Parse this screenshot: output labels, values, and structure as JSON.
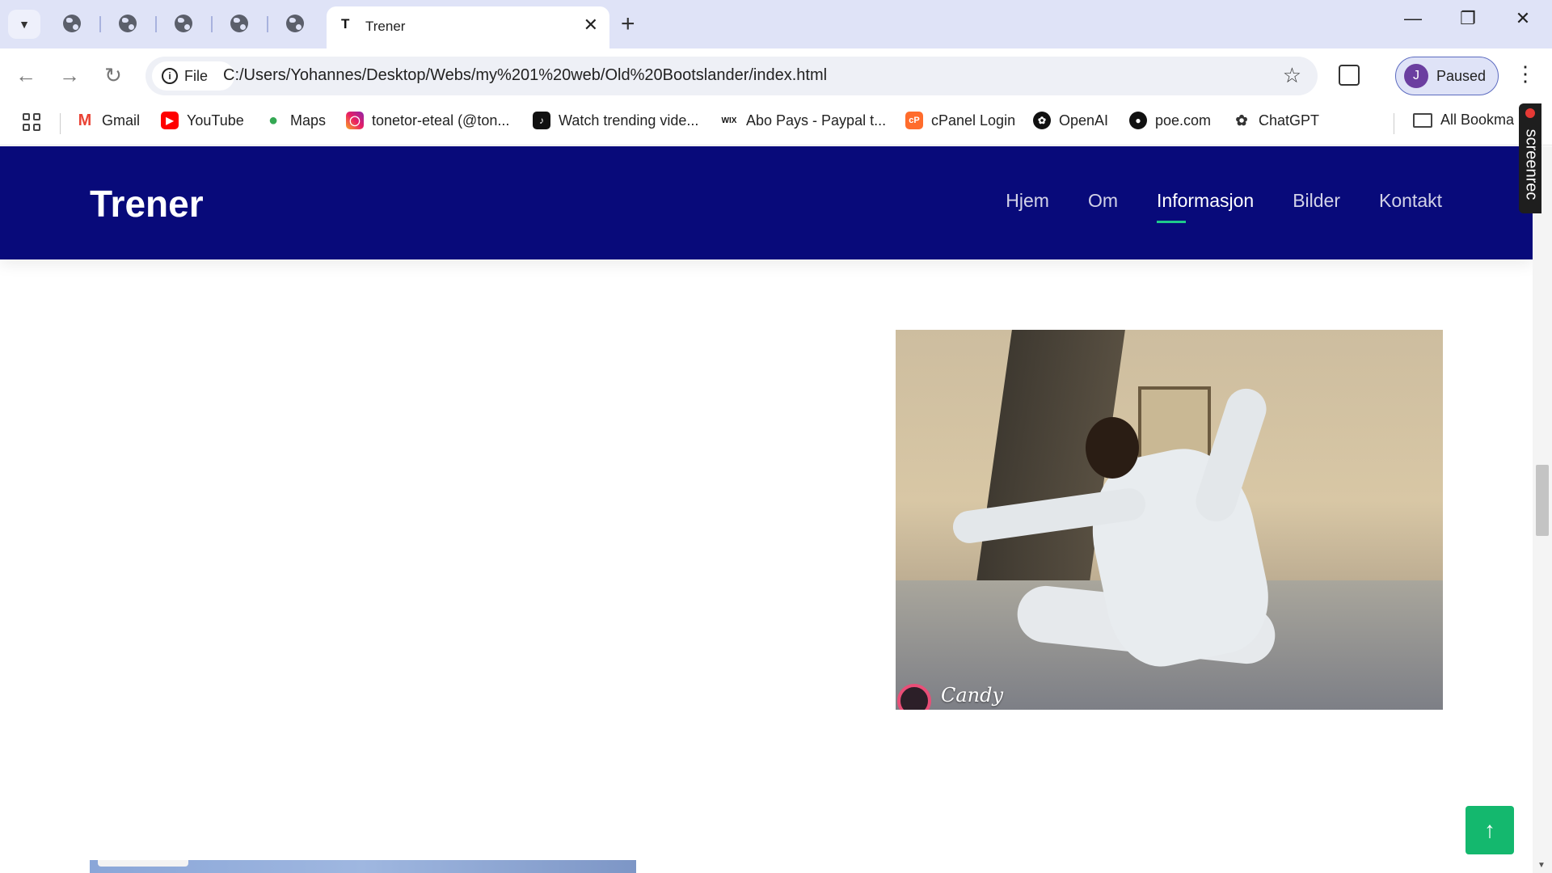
{
  "browser": {
    "active_tab": {
      "favicon": "T",
      "title": "Trener"
    },
    "omnibox": {
      "site_info_label": "File",
      "url": "C:/Users/Yohannes/Desktop/Webs/my%201%20web/Old%20Bootslander/index.html"
    },
    "profile": {
      "initial": "J",
      "status": "Paused"
    },
    "bookmarks": [
      {
        "label": "Gmail",
        "icon": "gmail-icon"
      },
      {
        "label": "YouTube",
        "icon": "youtube-icon"
      },
      {
        "label": "Maps",
        "icon": "maps-icon"
      },
      {
        "label": "tonetor-eteal (@ton...",
        "icon": "instagram-icon"
      },
      {
        "label": "Watch trending vide...",
        "icon": "tiktok-icon"
      },
      {
        "label": "Abo Pays - Paypal t...",
        "icon": "wix-icon"
      },
      {
        "label": "cPanel Login",
        "icon": "cpanel-icon"
      },
      {
        "label": "OpenAI",
        "icon": "openai-icon"
      },
      {
        "label": "poe.com",
        "icon": "poe-icon"
      },
      {
        "label": "ChatGPT",
        "icon": "chatgpt-icon"
      }
    ],
    "all_bookmarks_label": "All Bookma",
    "screenrec_label": "screenrec"
  },
  "site": {
    "logo": "Trener",
    "nav": [
      "Hjem",
      "Om",
      "Informasjon",
      "Bilder",
      "Kontakt"
    ],
    "active_nav": "Informasjon",
    "photo_watermark": "Candy",
    "back_to_top_icon": "arrow-up-icon"
  },
  "colors": {
    "header_bg": "#080a7a",
    "nav_underline": "#1fc98b",
    "back_to_top_bg": "#14b86e"
  }
}
